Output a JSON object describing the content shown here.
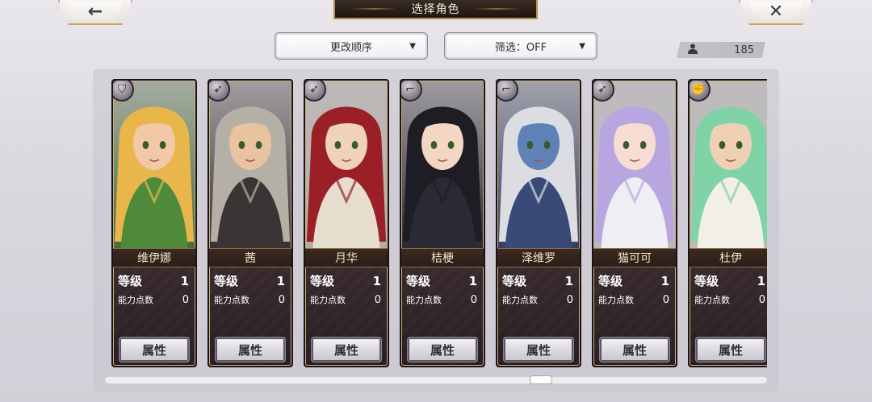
{
  "nav": {
    "back_glyph": "←",
    "close_glyph": "✕",
    "title": "选择角色"
  },
  "controls": {
    "order_label": "更改顺序",
    "filter_label": "筛选：OFF",
    "arrow_glyph": "▼"
  },
  "counter": {
    "icon": "person-icon",
    "value": "185"
  },
  "labels": {
    "level": "等级",
    "points": "能力点数",
    "attribute_button": "属性"
  },
  "characters": [
    {
      "name": "维伊娜",
      "level": "1",
      "points": "0",
      "class_icon": "shield-icon",
      "class_glyph": "⛉",
      "palette": [
        "#e8b64a",
        "#4f8a3a",
        "#f2c9a6"
      ]
    },
    {
      "name": "茜",
      "level": "1",
      "points": "0",
      "class_icon": "bow-icon",
      "class_glyph": "➶",
      "palette": [
        "#b5b0a6",
        "#3b3434",
        "#e9c2a0"
      ]
    },
    {
      "name": "月华",
      "level": "1",
      "points": "0",
      "class_icon": "bow-icon",
      "class_glyph": "➶",
      "palette": [
        "#9a1f26",
        "#e7ddcf",
        "#f0d2bb"
      ]
    },
    {
      "name": "桔梗",
      "level": "1",
      "points": "0",
      "class_icon": "gun-icon",
      "class_glyph": "⌐",
      "palette": [
        "#1f1d24",
        "#2a2a36",
        "#f3d7c4"
      ]
    },
    {
      "name": "泽维罗",
      "level": "1",
      "points": "0",
      "class_icon": "gun-icon",
      "class_glyph": "⌐",
      "palette": [
        "#dcdde3",
        "#3a4a78",
        "#5e82b6"
      ]
    },
    {
      "name": "猫可可",
      "level": "1",
      "points": "0",
      "class_icon": "bow-icon",
      "class_glyph": "➶",
      "palette": [
        "#b8a6e0",
        "#f0eef5",
        "#f6dcd2"
      ]
    },
    {
      "name": "杜伊",
      "level": "1",
      "points": "0",
      "class_icon": "fist-icon",
      "class_glyph": "✊",
      "palette": [
        "#7fd3a6",
        "#f2efe8",
        "#f0d0b4"
      ]
    }
  ]
}
